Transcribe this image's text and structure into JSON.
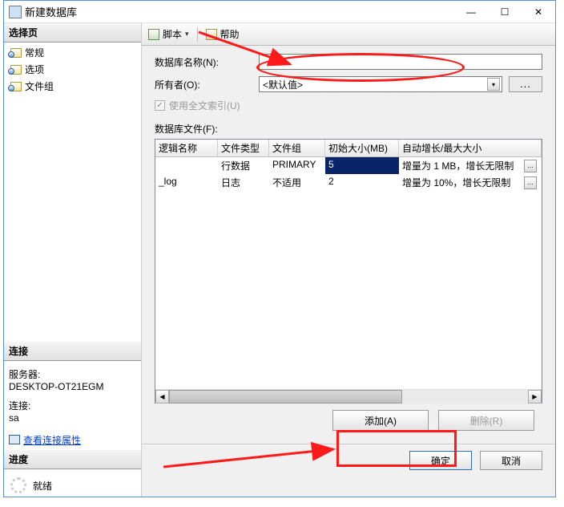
{
  "window": {
    "title": "新建数据库",
    "min": "—",
    "max": "☐",
    "close": "✕"
  },
  "sidebar": {
    "select_header": "选择页",
    "pages": [
      {
        "label": "常规"
      },
      {
        "label": "选项"
      },
      {
        "label": "文件组"
      }
    ],
    "connect_header": "连接",
    "server_label": "服务器:",
    "server_value": "DESKTOP-OT21EGM",
    "conn_label": "连接:",
    "conn_value": "sa",
    "view_conn_props": "查看连接属性",
    "progress_header": "进度",
    "status": "就绪"
  },
  "toolbar": {
    "script": "脚本",
    "help": "帮助",
    "drop": "▾"
  },
  "form": {
    "dbname_label": "数据库名称(N):",
    "dbname_value": "",
    "owner_label": "所有者(O):",
    "owner_value": "<默认值>",
    "owner_ellipsis": "...",
    "fulltext_label": "使用全文索引(U)",
    "fulltext_check": "✓",
    "files_label": "数据库文件(F):",
    "columns": {
      "c1": "逻辑名称",
      "c2": "文件类型",
      "c3": "文件组",
      "c4": "初始大小(MB)",
      "c5": "自动增长/最大大小"
    },
    "rows": [
      {
        "logical": "",
        "type": "行数据",
        "group": "PRIMARY",
        "size": "5",
        "growth": "增量为 1 MB，增长无限制",
        "selected": true
      },
      {
        "logical": "_log",
        "type": "日志",
        "group": "不适用",
        "size": "2",
        "growth": "增量为 10%，增长无限制",
        "selected": false
      }
    ],
    "add_btn": "添加(A)",
    "remove_btn": "删除(R)"
  },
  "footer": {
    "ok": "确定",
    "cancel": "取消"
  },
  "scroll": {
    "left": "◀",
    "right": "▶"
  }
}
